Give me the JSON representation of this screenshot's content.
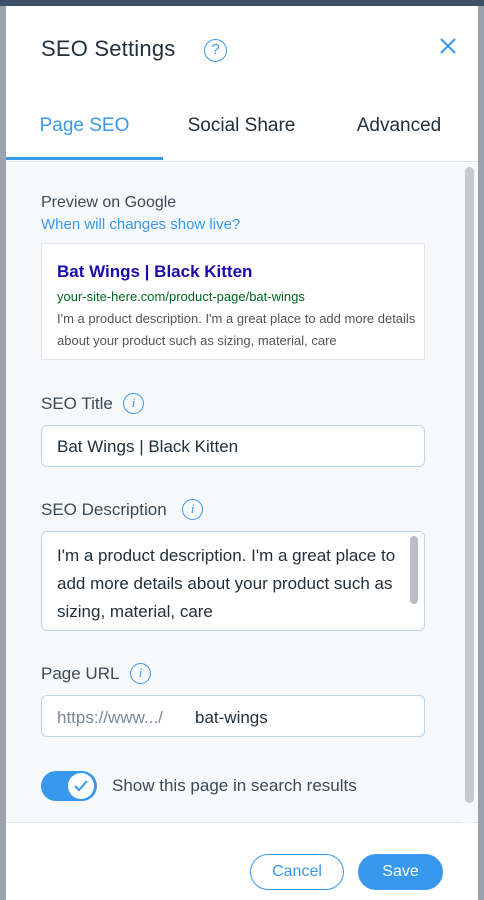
{
  "dialog": {
    "title": "SEO Settings",
    "help_glyph": "?",
    "close_glyph": "×"
  },
  "tabs": [
    {
      "label": "Page SEO",
      "active": true
    },
    {
      "label": "Social Share",
      "active": false
    },
    {
      "label": "Advanced",
      "active": false
    }
  ],
  "preview": {
    "section_label": "Preview on Google",
    "help_link": "When will changes show live?",
    "result_title": "Bat Wings | Black Kitten",
    "result_url": "your-site-here.com/product-page/bat-wings",
    "result_description": "I'm a product description. I'm a great place to add more details about your product such as sizing, material, care"
  },
  "seo_title": {
    "label": "SEO Title",
    "info_glyph": "i",
    "value": "Bat Wings | Black Kitten"
  },
  "seo_description": {
    "label": "SEO Description",
    "info_glyph": "i",
    "value": "I'm a product description. I'm a great place to add more details about your product such as sizing, material, care"
  },
  "page_url": {
    "label": "Page URL",
    "info_glyph": "i",
    "prefix": "https://www.../",
    "slug": "bat-wings"
  },
  "search_toggle": {
    "label": "Show this page in search results",
    "enabled": true
  },
  "footer": {
    "cancel_label": "Cancel",
    "save_label": "Save"
  },
  "colors": {
    "accent": "#3899ec",
    "header_bar": "#3d5067",
    "google_title": "#1a0dab",
    "google_url": "#006621"
  }
}
